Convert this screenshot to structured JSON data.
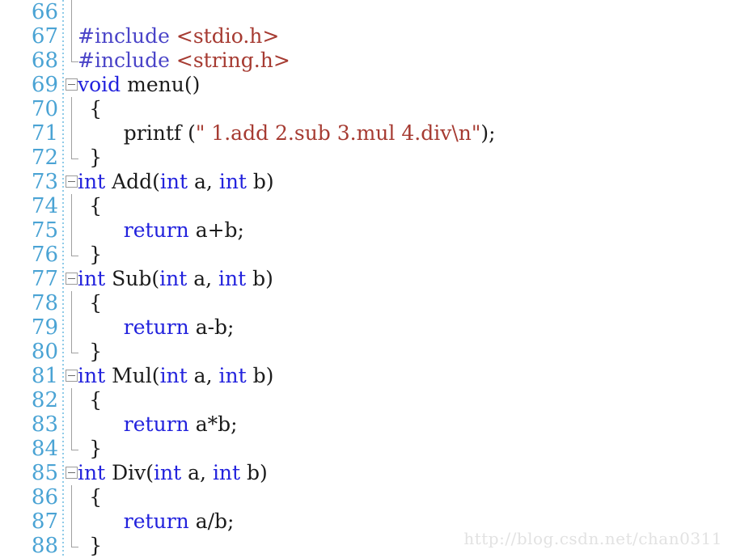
{
  "editor": {
    "background_color": "#ffffff",
    "line_number_color": "#4aa3d4",
    "keyword_color": "#2222dd",
    "string_color": "#a63b32",
    "preprocessor_color": "#4a44c8",
    "plain_color": "#1b1b1b",
    "fold_marker_color": "#9a9a9a",
    "first_line_number": 66,
    "last_line_number": 88
  },
  "watermark": {
    "text": "http://blog.csdn.net/chan0311"
  },
  "lines": [
    {
      "number": "66",
      "fold": "none",
      "guide": "full",
      "indent": 0,
      "tokens": []
    },
    {
      "number": "67",
      "fold": "none",
      "guide": "full",
      "indent": 0,
      "tokens": [
        {
          "t": "#include ",
          "c": "inc"
        },
        {
          "t": "<stdio.h>",
          "c": "str"
        }
      ]
    },
    {
      "number": "68",
      "fold": "none",
      "guide": "end",
      "indent": 0,
      "tokens": [
        {
          "t": "#include ",
          "c": "inc"
        },
        {
          "t": "<string.h>",
          "c": "str"
        }
      ]
    },
    {
      "number": "69",
      "fold": "box",
      "guide": "none",
      "indent": 0,
      "tokens": [
        {
          "t": "void",
          "c": "kw"
        },
        {
          "t": " menu()",
          "c": "pln"
        }
      ]
    },
    {
      "number": "70",
      "fold": "none",
      "guide": "full",
      "indent": 1,
      "tokens": [
        {
          "t": "{",
          "c": "pln"
        }
      ]
    },
    {
      "number": "71",
      "fold": "none",
      "guide": "full",
      "indent": 4,
      "tokens": [
        {
          "t": "printf (",
          "c": "pln"
        },
        {
          "t": "\" 1.add 2.sub 3.mul 4.div\\n\"",
          "c": "str"
        },
        {
          "t": ");",
          "c": "pln"
        }
      ]
    },
    {
      "number": "72",
      "fold": "none",
      "guide": "end",
      "indent": 1,
      "tokens": [
        {
          "t": "}",
          "c": "pln"
        }
      ]
    },
    {
      "number": "73",
      "fold": "box",
      "guide": "none",
      "indent": 0,
      "tokens": [
        {
          "t": "int",
          "c": "kw"
        },
        {
          "t": " Add(",
          "c": "pln"
        },
        {
          "t": "int",
          "c": "kw"
        },
        {
          "t": " a, ",
          "c": "pln"
        },
        {
          "t": "int",
          "c": "kw"
        },
        {
          "t": " b)",
          "c": "pln"
        }
      ]
    },
    {
      "number": "74",
      "fold": "none",
      "guide": "full",
      "indent": 1,
      "tokens": [
        {
          "t": "{",
          "c": "pln"
        }
      ]
    },
    {
      "number": "75",
      "fold": "none",
      "guide": "full",
      "indent": 4,
      "tokens": [
        {
          "t": "return",
          "c": "kw"
        },
        {
          "t": " a+b;",
          "c": "pln"
        }
      ]
    },
    {
      "number": "76",
      "fold": "none",
      "guide": "end",
      "indent": 1,
      "tokens": [
        {
          "t": "}",
          "c": "pln"
        }
      ]
    },
    {
      "number": "77",
      "fold": "box",
      "guide": "none",
      "indent": 0,
      "tokens": [
        {
          "t": "int",
          "c": "kw"
        },
        {
          "t": " Sub(",
          "c": "pln"
        },
        {
          "t": "int",
          "c": "kw"
        },
        {
          "t": " a, ",
          "c": "pln"
        },
        {
          "t": "int",
          "c": "kw"
        },
        {
          "t": " b)",
          "c": "pln"
        }
      ]
    },
    {
      "number": "78",
      "fold": "none",
      "guide": "full",
      "indent": 1,
      "tokens": [
        {
          "t": "{",
          "c": "pln"
        }
      ]
    },
    {
      "number": "79",
      "fold": "none",
      "guide": "full",
      "indent": 4,
      "tokens": [
        {
          "t": "return",
          "c": "kw"
        },
        {
          "t": " a-b;",
          "c": "pln"
        }
      ]
    },
    {
      "number": "80",
      "fold": "none",
      "guide": "end",
      "indent": 1,
      "tokens": [
        {
          "t": "}",
          "c": "pln"
        }
      ]
    },
    {
      "number": "81",
      "fold": "box",
      "guide": "none",
      "indent": 0,
      "tokens": [
        {
          "t": "int",
          "c": "kw"
        },
        {
          "t": " Mul(",
          "c": "pln"
        },
        {
          "t": "int",
          "c": "kw"
        },
        {
          "t": " a, ",
          "c": "pln"
        },
        {
          "t": "int",
          "c": "kw"
        },
        {
          "t": " b)",
          "c": "pln"
        }
      ]
    },
    {
      "number": "82",
      "fold": "none",
      "guide": "full",
      "indent": 1,
      "tokens": [
        {
          "t": "{",
          "c": "pln"
        }
      ]
    },
    {
      "number": "83",
      "fold": "none",
      "guide": "full",
      "indent": 4,
      "tokens": [
        {
          "t": "return",
          "c": "kw"
        },
        {
          "t": " a*b;",
          "c": "pln"
        }
      ]
    },
    {
      "number": "84",
      "fold": "none",
      "guide": "end",
      "indent": 1,
      "tokens": [
        {
          "t": "}",
          "c": "pln"
        }
      ]
    },
    {
      "number": "85",
      "fold": "box",
      "guide": "none",
      "indent": 0,
      "tokens": [
        {
          "t": "int",
          "c": "kw"
        },
        {
          "t": " Div(",
          "c": "pln"
        },
        {
          "t": "int",
          "c": "kw"
        },
        {
          "t": " a, ",
          "c": "pln"
        },
        {
          "t": "int",
          "c": "kw"
        },
        {
          "t": " b)",
          "c": "pln"
        }
      ]
    },
    {
      "number": "86",
      "fold": "none",
      "guide": "full",
      "indent": 1,
      "tokens": [
        {
          "t": "{",
          "c": "pln"
        }
      ]
    },
    {
      "number": "87",
      "fold": "none",
      "guide": "full",
      "indent": 4,
      "tokens": [
        {
          "t": "return",
          "c": "kw"
        },
        {
          "t": " a/b;",
          "c": "pln"
        }
      ]
    },
    {
      "number": "88",
      "fold": "none",
      "guide": "end",
      "indent": 1,
      "tokens": [
        {
          "t": "}",
          "c": "pln"
        }
      ]
    }
  ]
}
